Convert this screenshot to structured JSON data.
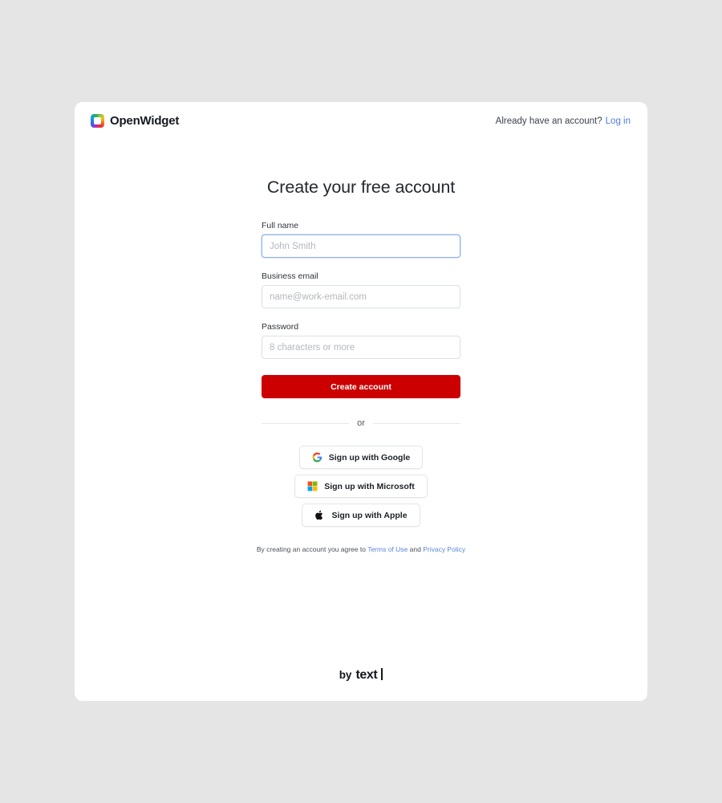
{
  "header": {
    "brand_name": "OpenWidget",
    "brand_mark_icon": "openwidget-logo-icon",
    "account_prompt": "Already have an account?",
    "login_label": "Log in"
  },
  "main": {
    "title": "Create your free account",
    "fields": [
      {
        "label": "Full name",
        "placeholder": "John Smith",
        "value": "",
        "focused": true,
        "type": "text"
      },
      {
        "label": "Business email",
        "placeholder": "name@work-email.com",
        "value": "",
        "focused": false,
        "type": "email"
      },
      {
        "label": "Password",
        "placeholder": "8 characters or more",
        "value": "",
        "focused": false,
        "type": "password"
      }
    ],
    "submit_label": "Create account",
    "divider_label": "or",
    "social_buttons": [
      {
        "label": "Sign up with Google",
        "icon": "google-icon"
      },
      {
        "label": "Sign up with Microsoft",
        "icon": "microsoft-icon"
      },
      {
        "label": "Sign up with Apple",
        "icon": "apple-icon"
      }
    ],
    "legal": {
      "prefix": "By creating an account you agree to",
      "terms_label": "Terms of Use",
      "conjunction": "and",
      "privacy_label": "Privacy Policy"
    }
  },
  "footer": {
    "by_label": "by",
    "product_label": "text"
  },
  "colors": {
    "page_background": "#e5e5e5",
    "card_background": "#ffffff",
    "primary_button": "#cc0000",
    "link": "#5b86d8",
    "focus_border": "#8fb3ee",
    "input_border": "#dcdfe3"
  }
}
